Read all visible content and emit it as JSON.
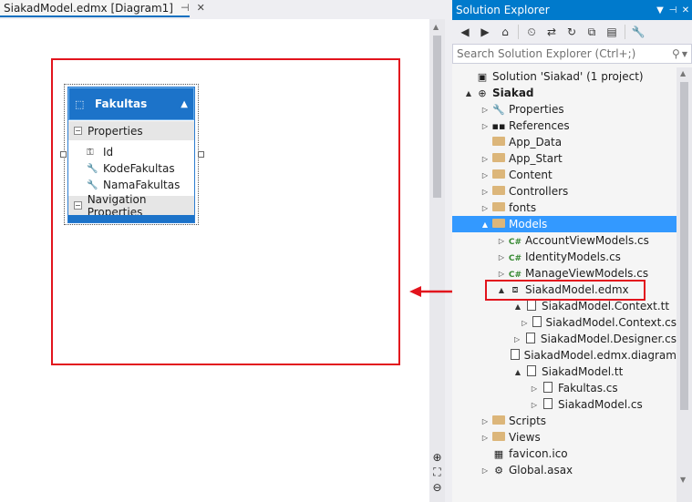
{
  "document_tab": {
    "title": "SiakadModel.edmx [Diagram1]",
    "pin": "⊣",
    "close": "✕"
  },
  "entity": {
    "name": "Fakultas",
    "properties_header": "Properties",
    "properties": [
      "Id",
      "KodeFakultas",
      "NamaFakultas"
    ],
    "navigation_header": "Navigation Properties"
  },
  "solution_explorer": {
    "title": "Solution Explorer",
    "search_placeholder": "Search Solution Explorer (Ctrl+;)",
    "tree": [
      {
        "label": "Solution 'Siakad' (1 project)",
        "level": 0,
        "expander": "",
        "icon": "solution",
        "bold": false
      },
      {
        "label": "Siakad",
        "level": 0,
        "expander": "▲",
        "icon": "project",
        "bold": true
      },
      {
        "label": "Properties",
        "level": 1,
        "expander": "▷",
        "icon": "wrench"
      },
      {
        "label": "References",
        "level": 1,
        "expander": "▷",
        "icon": "references"
      },
      {
        "label": "App_Data",
        "level": 1,
        "expander": "",
        "icon": "folder"
      },
      {
        "label": "App_Start",
        "level": 1,
        "expander": "▷",
        "icon": "folder"
      },
      {
        "label": "Content",
        "level": 1,
        "expander": "▷",
        "icon": "folder"
      },
      {
        "label": "Controllers",
        "level": 1,
        "expander": "▷",
        "icon": "folder"
      },
      {
        "label": "fonts",
        "level": 1,
        "expander": "▷",
        "icon": "folder"
      },
      {
        "label": "Models",
        "level": 1,
        "expander": "▲",
        "icon": "folder-open",
        "selected": true
      },
      {
        "label": "AccountViewModels.cs",
        "level": 2,
        "expander": "▷",
        "icon": "cs"
      },
      {
        "label": "IdentityModels.cs",
        "level": 2,
        "expander": "▷",
        "icon": "cs"
      },
      {
        "label": "ManageViewModels.cs",
        "level": 2,
        "expander": "▷",
        "icon": "cs"
      },
      {
        "label": "SiakadModel.edmx",
        "level": 2,
        "expander": "▲",
        "icon": "edmx"
      },
      {
        "label": "SiakadModel.Context.tt",
        "level": 3,
        "expander": "▲",
        "icon": "file"
      },
      {
        "label": "SiakadModel.Context.cs",
        "level": 4,
        "expander": "▷",
        "icon": "file"
      },
      {
        "label": "SiakadModel.Designer.cs",
        "level": 3,
        "expander": "▷",
        "icon": "file"
      },
      {
        "label": "SiakadModel.edmx.diagram",
        "level": 3,
        "expander": "",
        "icon": "file"
      },
      {
        "label": "SiakadModel.tt",
        "level": 3,
        "expander": "▲",
        "icon": "file"
      },
      {
        "label": "Fakultas.cs",
        "level": 4,
        "expander": "▷",
        "icon": "file"
      },
      {
        "label": "SiakadModel.cs",
        "level": 4,
        "expander": "▷",
        "icon": "file"
      },
      {
        "label": "Scripts",
        "level": 1,
        "expander": "▷",
        "icon": "folder"
      },
      {
        "label": "Views",
        "level": 1,
        "expander": "▷",
        "icon": "folder"
      },
      {
        "label": "favicon.ico",
        "level": 1,
        "expander": "",
        "icon": "image"
      },
      {
        "label": "Global.asax",
        "level": 1,
        "expander": "▷",
        "icon": "global"
      }
    ]
  },
  "colors": {
    "accent": "#007acc",
    "selection": "#3399ff",
    "annotation": "#e2141d",
    "entity_header": "#1c73c9"
  }
}
